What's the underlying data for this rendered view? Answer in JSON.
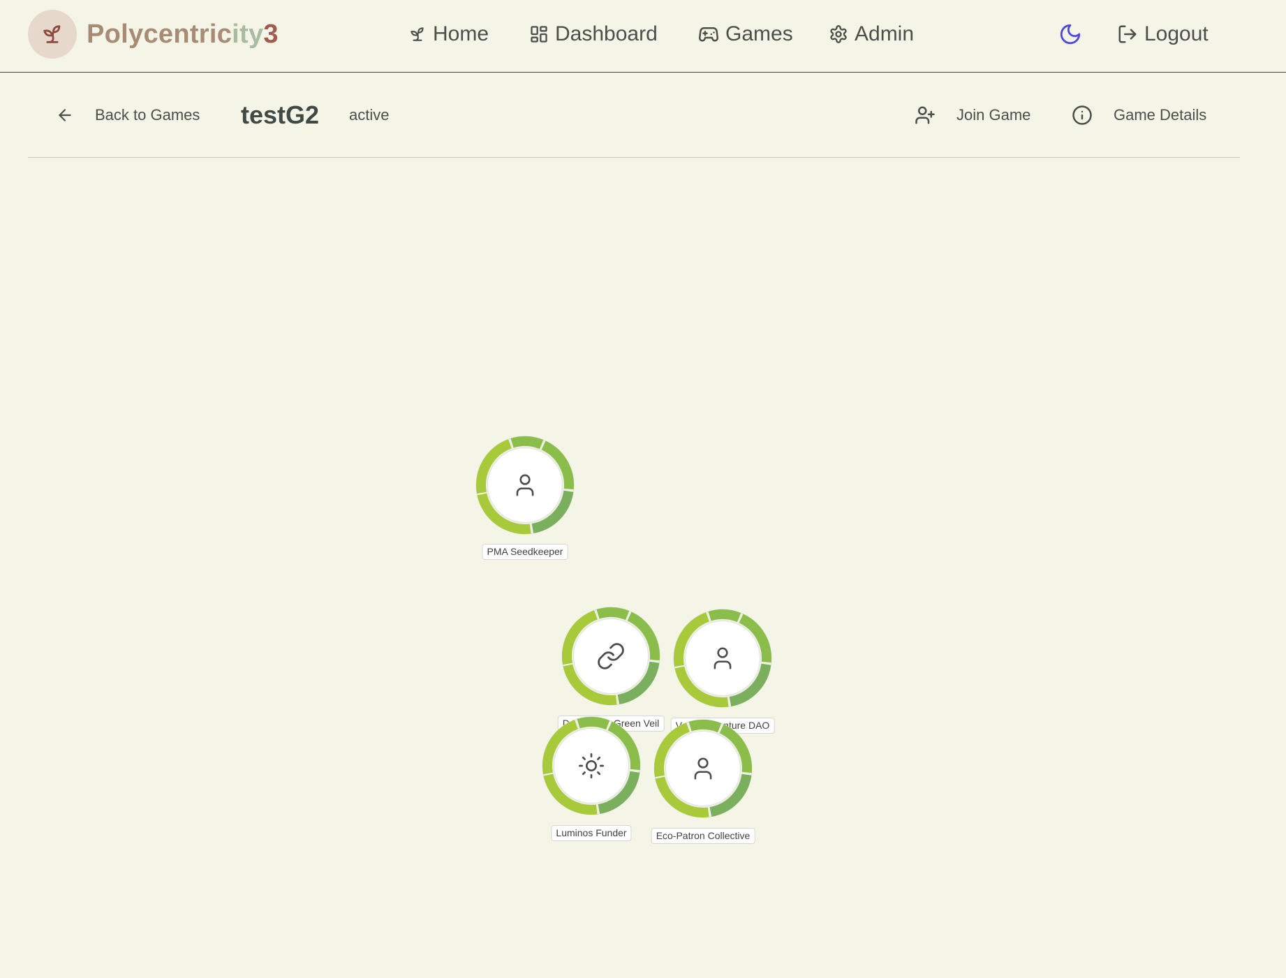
{
  "app": {
    "brand_part1": "Polycentric",
    "brand_part2": "ity",
    "brand_part3": "3"
  },
  "nav": {
    "items": [
      {
        "label": "Home",
        "icon": "sprout-icon"
      },
      {
        "label": "Dashboard",
        "icon": "dashboard-grid-icon"
      },
      {
        "label": "Games",
        "icon": "gamepad-icon"
      },
      {
        "label": "Admin",
        "icon": "gear-icon"
      }
    ],
    "theme_toggle_icon": "moon-icon",
    "logout_label": "Logout"
  },
  "game": {
    "back_label": "Back to Games",
    "title": "testG2",
    "status": "active",
    "join_label": "Join Game",
    "details_label": "Game Details"
  },
  "nodes": [
    {
      "label": "PMA Seedkeeper",
      "icon": "person-icon"
    },
    {
      "label": "DAO of the Green Veil",
      "icon": "link-icon"
    },
    {
      "label": "Verdant Venture DAO",
      "icon": "person-icon"
    },
    {
      "label": "Luminos Funder",
      "icon": "sun-icon"
    },
    {
      "label": "Eco-Patron Collective",
      "icon": "person-icon"
    }
  ],
  "colors": {
    "background": "#f4f5e7",
    "ring_light": "#a7c93a",
    "ring_mid": "#8bbd4b",
    "ring_dark": "#7aaf5e",
    "theme_toggle": "#4f46e5"
  }
}
